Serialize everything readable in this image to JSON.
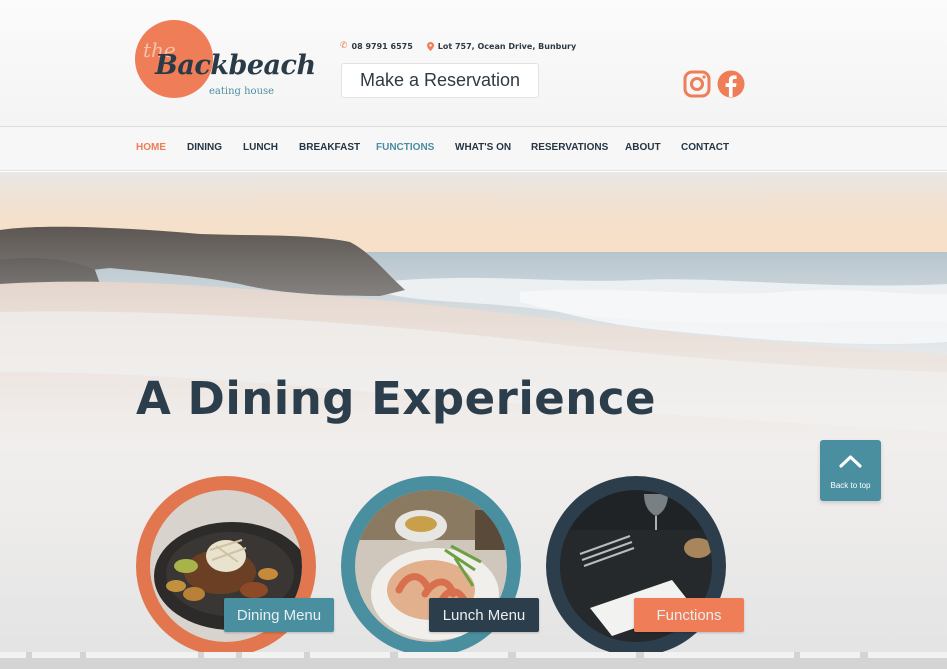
{
  "logo": {
    "the": "the",
    "name": "Backbeach",
    "tagline": "eating house"
  },
  "contact": {
    "phone": "08 9791 6575",
    "address": "Lot 757, Ocean Drive, Bunbury"
  },
  "reservation_button": "Make a Reservation",
  "social": [
    "instagram-icon",
    "facebook-icon"
  ],
  "nav": {
    "items": [
      "HOME",
      "DINING",
      "LUNCH",
      "BREAKFAST",
      "FUNCTIONS",
      "WHAT'S ON",
      "RESERVATIONS",
      "ABOUT",
      "CONTACT"
    ],
    "active": "HOME"
  },
  "hero": {
    "title": "A Dining Experience"
  },
  "back_to_top": "Back to top",
  "cards": [
    {
      "label": "Dining Menu"
    },
    {
      "label": "Lunch Menu"
    },
    {
      "label": "Functions"
    }
  ],
  "colors": {
    "brand_orange": "#ef7d57",
    "brand_teal": "#4a8fa0",
    "brand_navy": "#2c3e4c"
  }
}
